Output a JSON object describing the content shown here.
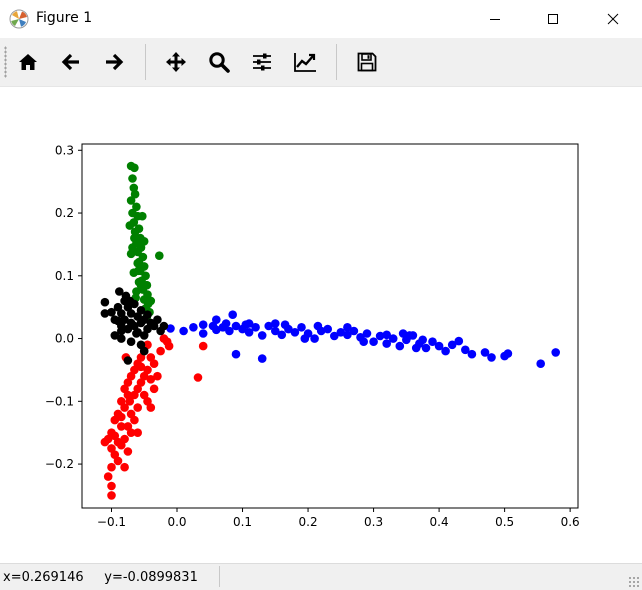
{
  "window": {
    "title": "Figure 1",
    "icons": [
      "matplotlib-icon",
      "minimize-icon",
      "maximize-icon",
      "close-icon"
    ]
  },
  "toolbar": {
    "buttons": [
      {
        "name": "home",
        "icon": "home-icon"
      },
      {
        "name": "back",
        "icon": "arrow-left-icon"
      },
      {
        "name": "forward",
        "icon": "arrow-right-icon"
      },
      {
        "name": "pan",
        "icon": "move-icon"
      },
      {
        "name": "zoom",
        "icon": "magnifier-icon"
      },
      {
        "name": "subplots",
        "icon": "sliders-icon"
      },
      {
        "name": "customize",
        "icon": "line-chart-icon"
      },
      {
        "name": "save",
        "icon": "floppy-disk-icon"
      }
    ]
  },
  "status": {
    "coords": "x=0.269146     y=-0.0899831"
  },
  "colors": {
    "blue": "#0000ff",
    "green": "#008000",
    "red": "#ff0000",
    "black": "#000000"
  },
  "chart_data": {
    "type": "scatter",
    "title": "",
    "xlabel": "",
    "ylabel": "",
    "xlim": [
      -0.145,
      0.612
    ],
    "ylim": [
      -0.27,
      0.31
    ],
    "xticks": [
      -0.1,
      0.0,
      0.1,
      0.2,
      0.3,
      0.4,
      0.5,
      0.6
    ],
    "xtick_labels": [
      "−0.1",
      "0.0",
      "0.1",
      "0.2",
      "0.3",
      "0.4",
      "0.5",
      "0.6"
    ],
    "yticks": [
      -0.2,
      -0.1,
      0.0,
      0.1,
      0.2,
      0.3
    ],
    "ytick_labels": [
      "−0.2",
      "−0.1",
      "0.0",
      "0.1",
      "0.2",
      "0.3"
    ],
    "grid": false,
    "series": [
      {
        "color": "#0000ff",
        "points": [
          [
            -0.01,
            0.016
          ],
          [
            0.01,
            0.012
          ],
          [
            0.025,
            0.018
          ],
          [
            0.04,
            0.022
          ],
          [
            0.04,
            0.008
          ],
          [
            0.055,
            0.02
          ],
          [
            0.06,
            0.014
          ],
          [
            0.07,
            0.018
          ],
          [
            0.075,
            0.024
          ],
          [
            0.08,
            0.012
          ],
          [
            0.085,
            0.038
          ],
          [
            0.09,
            0.02
          ],
          [
            0.1,
            0.015
          ],
          [
            0.105,
            0.022
          ],
          [
            0.11,
            0.01
          ],
          [
            0.12,
            0.018
          ],
          [
            0.13,
            0.005
          ],
          [
            0.14,
            0.02
          ],
          [
            0.15,
            0.012
          ],
          [
            0.16,
            0.006
          ],
          [
            0.17,
            0.015
          ],
          [
            0.18,
            0.01
          ],
          [
            0.19,
            0.018
          ],
          [
            0.2,
            0.008
          ],
          [
            0.21,
            0.0
          ],
          [
            0.22,
            0.012
          ],
          [
            0.23,
            0.015
          ],
          [
            0.24,
            0.004
          ],
          [
            0.25,
            0.01
          ],
          [
            0.26,
            0.006
          ],
          [
            0.27,
            0.012
          ],
          [
            0.28,
            0.002
          ],
          [
            0.29,
            0.008
          ],
          [
            0.3,
            -0.005
          ],
          [
            0.31,
            0.004
          ],
          [
            0.32,
            -0.008
          ],
          [
            0.33,
            0.0
          ],
          [
            0.34,
            -0.012
          ],
          [
            0.35,
            -0.002
          ],
          [
            0.36,
            0.005
          ],
          [
            0.37,
            -0.008
          ],
          [
            0.38,
            -0.015
          ],
          [
            0.39,
            -0.005
          ],
          [
            0.4,
            -0.012
          ],
          [
            0.41,
            -0.02
          ],
          [
            0.42,
            -0.01
          ],
          [
            0.44,
            -0.018
          ],
          [
            0.45,
            -0.025
          ],
          [
            0.47,
            -0.022
          ],
          [
            0.48,
            -0.03
          ],
          [
            0.5,
            -0.028
          ],
          [
            0.505,
            -0.024
          ],
          [
            0.555,
            -0.04
          ],
          [
            0.578,
            -0.022
          ],
          [
            0.09,
            -0.025
          ],
          [
            0.13,
            -0.032
          ],
          [
            0.06,
            0.03
          ],
          [
            0.165,
            0.022
          ],
          [
            0.215,
            0.02
          ],
          [
            0.26,
            0.018
          ],
          [
            0.345,
            0.008
          ],
          [
            0.355,
            0.005
          ],
          [
            0.365,
            -0.015
          ],
          [
            0.375,
            -0.002
          ],
          [
            0.15,
            0.024
          ],
          [
            0.11,
            0.024
          ],
          [
            0.195,
            0.0
          ],
          [
            0.285,
            -0.005
          ],
          [
            0.32,
            0.006
          ],
          [
            0.43,
            -0.004
          ]
        ]
      },
      {
        "color": "#008000",
        "points": [
          [
            -0.07,
            0.275
          ],
          [
            -0.065,
            0.272
          ],
          [
            -0.068,
            0.255
          ],
          [
            -0.066,
            0.24
          ],
          [
            -0.064,
            0.23
          ],
          [
            -0.07,
            0.22
          ],
          [
            -0.062,
            0.21
          ],
          [
            -0.068,
            0.2
          ],
          [
            -0.06,
            0.195
          ],
          [
            -0.066,
            0.185
          ],
          [
            -0.058,
            0.175
          ],
          [
            -0.064,
            0.17
          ],
          [
            -0.056,
            0.16
          ],
          [
            -0.062,
            0.152
          ],
          [
            -0.055,
            0.145
          ],
          [
            -0.06,
            0.138
          ],
          [
            -0.052,
            0.13
          ],
          [
            -0.058,
            0.122
          ],
          [
            -0.05,
            0.115
          ],
          [
            -0.056,
            0.108
          ],
          [
            -0.048,
            0.1
          ],
          [
            -0.054,
            0.092
          ],
          [
            -0.046,
            0.085
          ],
          [
            -0.052,
            0.078
          ],
          [
            -0.045,
            0.07
          ],
          [
            -0.05,
            0.062
          ],
          [
            -0.044,
            0.055
          ],
          [
            -0.048,
            0.048
          ],
          [
            -0.042,
            0.042
          ],
          [
            -0.046,
            0.035
          ],
          [
            -0.065,
            0.16
          ],
          [
            -0.07,
            0.135
          ],
          [
            -0.06,
            0.12
          ],
          [
            -0.066,
            0.105
          ],
          [
            -0.058,
            0.09
          ],
          [
            -0.062,
            0.075
          ],
          [
            -0.027,
            0.132
          ],
          [
            -0.04,
            0.06
          ],
          [
            -0.053,
            0.195
          ],
          [
            -0.072,
            0.18
          ],
          [
            -0.055,
            0.085
          ],
          [
            -0.063,
            0.065
          ],
          [
            -0.068,
            0.145
          ],
          [
            -0.05,
            0.155
          ],
          [
            -0.059,
            0.108
          ]
        ]
      },
      {
        "color": "#ff0000",
        "points": [
          [
            -0.045,
            -0.01
          ],
          [
            -0.05,
            -0.02
          ],
          [
            -0.055,
            -0.03
          ],
          [
            -0.06,
            -0.04
          ],
          [
            -0.065,
            -0.05
          ],
          [
            -0.07,
            -0.06
          ],
          [
            -0.075,
            -0.07
          ],
          [
            -0.08,
            -0.08
          ],
          [
            -0.075,
            -0.09
          ],
          [
            -0.085,
            -0.1
          ],
          [
            -0.08,
            -0.11
          ],
          [
            -0.09,
            -0.12
          ],
          [
            -0.095,
            -0.13
          ],
          [
            -0.085,
            -0.14
          ],
          [
            -0.1,
            -0.15
          ],
          [
            -0.105,
            -0.16
          ],
          [
            -0.11,
            -0.165
          ],
          [
            -0.1,
            -0.175
          ],
          [
            -0.095,
            -0.185
          ],
          [
            -0.09,
            -0.195
          ],
          [
            -0.08,
            -0.205
          ],
          [
            -0.1,
            -0.205
          ],
          [
            -0.105,
            -0.22
          ],
          [
            -0.1,
            -0.235
          ],
          [
            -0.1,
            -0.25
          ],
          [
            -0.04,
            -0.03
          ],
          [
            -0.035,
            -0.04
          ],
          [
            -0.045,
            -0.05
          ],
          [
            -0.05,
            -0.06
          ],
          [
            -0.055,
            -0.07
          ],
          [
            -0.06,
            -0.08
          ],
          [
            -0.05,
            -0.09
          ],
          [
            -0.045,
            -0.1
          ],
          [
            -0.06,
            -0.11
          ],
          [
            -0.07,
            -0.12
          ],
          [
            -0.065,
            -0.13
          ],
          [
            -0.075,
            -0.14
          ],
          [
            -0.07,
            -0.15
          ],
          [
            -0.08,
            -0.16
          ],
          [
            -0.085,
            -0.17
          ],
          [
            -0.02,
            0.0
          ],
          [
            -0.015,
            -0.005
          ],
          [
            -0.025,
            -0.02
          ],
          [
            -0.03,
            -0.06
          ],
          [
            -0.035,
            -0.08
          ],
          [
            -0.04,
            -0.11
          ],
          [
            0.04,
            -0.012
          ],
          [
            0.032,
            -0.062
          ],
          [
            -0.012,
            -0.012
          ],
          [
            -0.06,
            -0.15
          ],
          [
            -0.075,
            -0.18
          ],
          [
            -0.09,
            -0.165
          ],
          [
            -0.095,
            -0.155
          ],
          [
            -0.085,
            -0.125
          ],
          [
            -0.072,
            -0.1
          ],
          [
            -0.065,
            -0.09
          ],
          [
            -0.055,
            -0.045
          ],
          [
            -0.04,
            -0.065
          ],
          [
            -0.078,
            -0.03
          ]
        ]
      },
      {
        "color": "#000000",
        "points": [
          [
            -0.11,
            0.04
          ],
          [
            -0.11,
            0.058
          ],
          [
            -0.1,
            0.042
          ],
          [
            -0.095,
            0.03
          ],
          [
            -0.09,
            0.05
          ],
          [
            -0.085,
            0.04
          ],
          [
            -0.085,
            0.02
          ],
          [
            -0.08,
            0.06
          ],
          [
            -0.08,
            0.03
          ],
          [
            -0.075,
            0.05
          ],
          [
            -0.075,
            0.015
          ],
          [
            -0.07,
            0.04
          ],
          [
            -0.07,
            0.025
          ],
          [
            -0.065,
            0.055
          ],
          [
            -0.065,
            0.02
          ],
          [
            -0.06,
            0.035
          ],
          [
            -0.06,
            0.01
          ],
          [
            -0.055,
            0.045
          ],
          [
            -0.055,
            0.025
          ],
          [
            -0.05,
            0.03
          ],
          [
            -0.05,
            0.005
          ],
          [
            -0.045,
            0.015
          ],
          [
            -0.045,
            0.038
          ],
          [
            -0.04,
            0.025
          ],
          [
            -0.035,
            0.02
          ],
          [
            -0.03,
            0.03
          ],
          [
            -0.025,
            0.012
          ],
          [
            -0.02,
            0.02
          ],
          [
            -0.095,
            0.005
          ],
          [
            -0.085,
            0.0
          ],
          [
            -0.07,
            -0.005
          ],
          [
            -0.055,
            -0.01
          ],
          [
            -0.05,
            -0.02
          ],
          [
            -0.075,
            -0.035
          ],
          [
            -0.088,
            0.075
          ],
          [
            -0.078,
            0.068
          ],
          [
            -0.085,
            0.012
          ],
          [
            -0.062,
            0.008
          ],
          [
            -0.09,
            0.028
          ],
          [
            -0.072,
            0.06
          ]
        ]
      }
    ]
  }
}
